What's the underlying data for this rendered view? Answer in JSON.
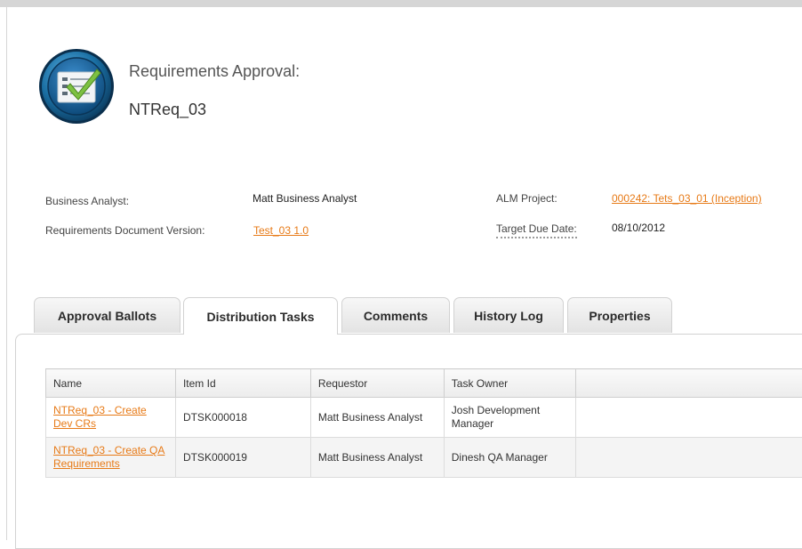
{
  "page": {
    "title": "Requirements Approval:",
    "name": "NTReq_03",
    "icon": "approval-checklist-icon"
  },
  "details": {
    "business_analyst_label": "Business Analyst:",
    "business_analyst_value": "Matt Business Analyst",
    "req_doc_version_label": "Requirements Document Version:",
    "req_doc_version_value": "Test_03 1.0",
    "alm_project_label": "ALM Project:",
    "alm_project_value": "000242: Tets_03_01 (Inception)",
    "target_due_date_label": "Target Due Date:",
    "target_due_date_value": "08/10/2012"
  },
  "tabs": [
    {
      "label": "Approval Ballots",
      "active": false
    },
    {
      "label": "Distribution Tasks",
      "active": true
    },
    {
      "label": "Comments",
      "active": false
    },
    {
      "label": "History Log",
      "active": false
    },
    {
      "label": "Properties",
      "active": false
    }
  ],
  "table": {
    "columns": [
      "Name",
      "Item Id",
      "Requestor",
      "Task Owner"
    ],
    "rows": [
      {
        "name": "NTReq_03 - Create Dev CRs",
        "item_id": "DTSK000018",
        "requestor": "Matt Business Analyst",
        "task_owner": "Josh Development Manager"
      },
      {
        "name": "NTReq_03 - Create QA Requirements",
        "item_id": "DTSK000019",
        "requestor": "Matt Business Analyst",
        "task_owner": "Dinesh QA Manager"
      }
    ]
  },
  "colors": {
    "link": "#e77a17",
    "icon_ring": "#1a6fa3",
    "check": "#7dc142"
  }
}
